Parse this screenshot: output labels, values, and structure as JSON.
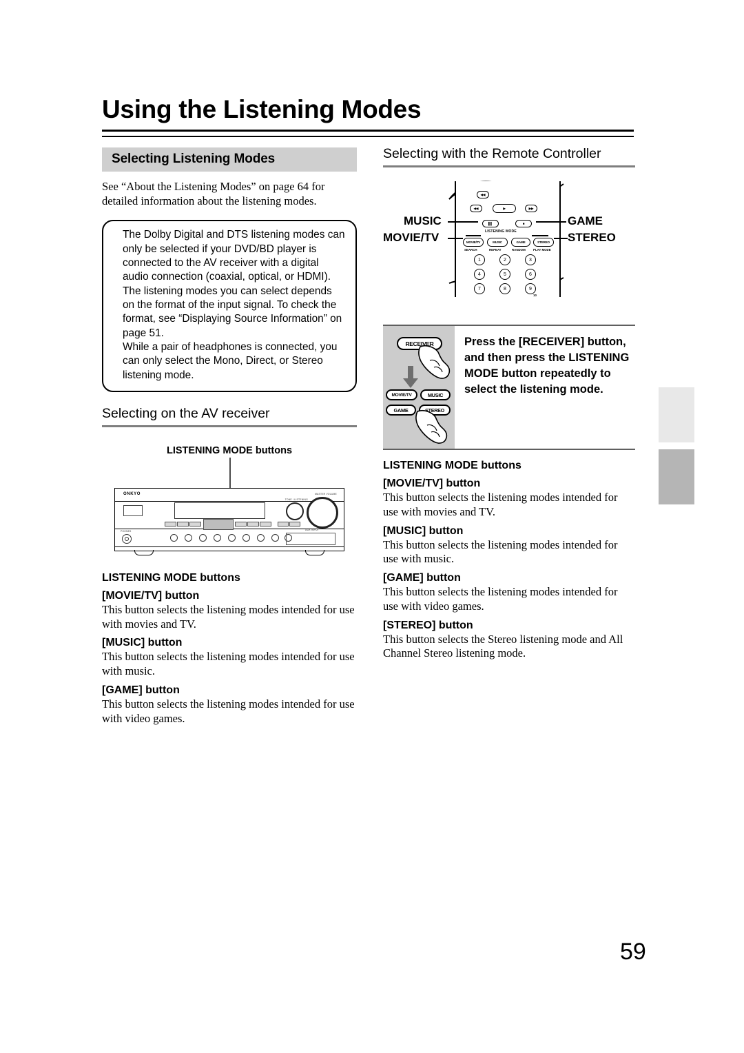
{
  "document": {
    "title": "Using the Listening Modes",
    "page_number": "59"
  },
  "left_column": {
    "banner_heading": "Selecting Listening Modes",
    "intro": "See “About the Listening Modes” on page 64 for detailed information about the listening modes.",
    "note_box": {
      "paragraphs": [
        "The Dolby Digital and DTS listening modes can only be selected if your DVD/BD player is connected to the AV receiver with a digital audio connection (coaxial, optical, or HDMI).",
        "The listening modes you can select depends on the format of the input signal. To check the format, see “Displaying Source Information” on page 51.",
        "While a pair of headphones is connected, you can only select the Mono, Direct, or Stereo listening mode."
      ]
    },
    "sub_heading": "Selecting on the AV receiver",
    "figure_callout": "LISTENING MODE buttons",
    "receiver": {
      "brand": "ONKYO",
      "volume_label": "MASTER VOLUME",
      "selector_label": "TONE / LISTENING",
      "phones_label": "PHONES",
      "aux_label": "AUX INPUT",
      "aux_jacks": [
        "VIDEO",
        "AUDIO",
        "L",
        "R"
      ],
      "input_labels": [
        "BD/DVD",
        "VCR/DVR",
        "CBL/SAT",
        "GAME",
        "AUX",
        "TV/TAPE",
        "TUNER",
        "CD",
        "PORT"
      ],
      "listening_mode_group": "LISTENING MODE"
    },
    "definitions": {
      "group_title": "LISTENING MODE buttons",
      "items": [
        {
          "term": "[MOVIE/TV] button",
          "desc": "This button selects the listening modes intended for use with movies and TV."
        },
        {
          "term": "[MUSIC] button",
          "desc": "This button selects the listening modes intended for use with music."
        },
        {
          "term": "[GAME] button",
          "desc": "This button selects the listening modes intended for use with video games."
        }
      ]
    }
  },
  "right_column": {
    "sub_heading": "Selecting with the Remote Controller",
    "remote": {
      "section_label": "LISTENING MODE",
      "buttons": [
        {
          "label": "MOVIE/TV",
          "sub": "SEARCH"
        },
        {
          "label": "MUSIC",
          "sub": "REPEAT"
        },
        {
          "label": "GAME",
          "sub": "RANDOM"
        },
        {
          "label": "STEREO",
          "sub": "PLAY MODE"
        }
      ],
      "callouts_left": [
        "MUSIC",
        "MOVIE/TV"
      ],
      "callouts_right": [
        "GAME",
        "STEREO"
      ],
      "transport_icons": [
        "prev-track-icon",
        "rewind-icon",
        "play-icon",
        "fast-forward-icon",
        "pause-icon",
        "stop-icon"
      ],
      "keypad": [
        "1",
        "2",
        "3",
        "4",
        "5",
        "6",
        "7",
        "8",
        "9"
      ],
      "keypad_extra": "10"
    },
    "instruction": {
      "text": "Press the [RECEIVER] button, and then press the LISTENING MODE button repeatedly to select the listening mode.",
      "art_buttons": [
        "RECEIVER",
        "MOVIE/TV",
        "MUSIC",
        "GAME",
        "STEREO"
      ]
    },
    "definitions": {
      "group_title": "LISTENING MODE buttons",
      "items": [
        {
          "term": "[MOVIE/TV] button",
          "desc": "This button selects the listening modes intended for use with movies and TV."
        },
        {
          "term": "[MUSIC] button",
          "desc": "This button selects the listening modes intended for use with music."
        },
        {
          "term": "[GAME] button",
          "desc": "This button selects the listening modes intended for use with video games."
        },
        {
          "term": "[STEREO] button",
          "desc": "This button selects the Stereo listening mode and All Channel Stereo listening mode."
        }
      ]
    }
  },
  "colors": {
    "banner_gray": "#cfcfcf",
    "panel_gray": "#cccccc",
    "tab_light": "#e8e8e8",
    "tab_dark": "#b5b5b5",
    "rule_gray": "#7e7e7e"
  }
}
